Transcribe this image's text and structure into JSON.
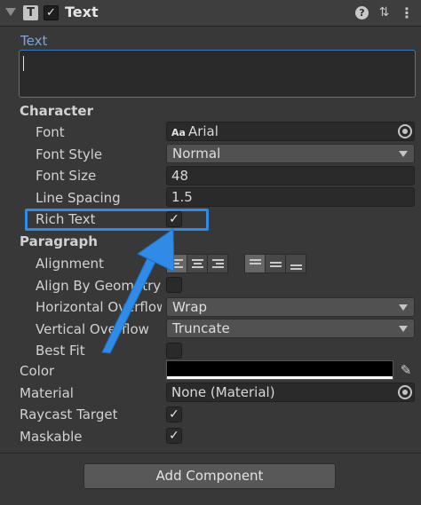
{
  "component": {
    "title": "Text",
    "icon": "text-component-icon",
    "enabled": true
  },
  "text_field": {
    "label": "Text",
    "value": ""
  },
  "character": {
    "section_label": "Character",
    "font": {
      "label": "Font",
      "value": "Arial",
      "prefix": "Aa"
    },
    "font_style": {
      "label": "Font Style",
      "value": "Normal"
    },
    "font_size": {
      "label": "Font Size",
      "value": "48"
    },
    "line_spacing": {
      "label": "Line Spacing",
      "value": "1.5"
    },
    "rich_text": {
      "label": "Rich Text",
      "checked": true
    }
  },
  "paragraph": {
    "section_label": "Paragraph",
    "alignment": {
      "label": "Alignment"
    },
    "align_by_geometry": {
      "label": "Align By Geometry",
      "checked": false
    },
    "horizontal_overflow": {
      "label": "Horizontal Overflow",
      "value": "Wrap"
    },
    "vertical_overflow": {
      "label": "Vertical Overflow",
      "value": "Truncate"
    },
    "best_fit": {
      "label": "Best Fit",
      "checked": false
    }
  },
  "color": {
    "label": "Color",
    "value": "#000000"
  },
  "material": {
    "label": "Material",
    "value": "None (Material)"
  },
  "raycast_target": {
    "label": "Raycast Target",
    "checked": true
  },
  "maskable": {
    "label": "Maskable",
    "checked": true
  },
  "add_component": {
    "label": "Add Component"
  },
  "annotation": {
    "color": "#2f8be6"
  }
}
